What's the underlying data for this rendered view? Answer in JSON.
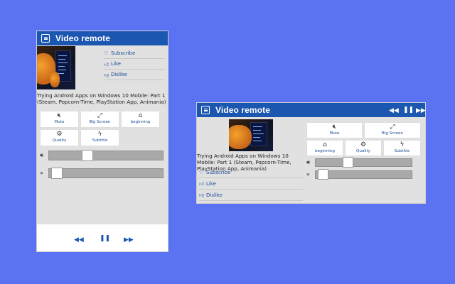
{
  "app": {
    "title": "Video remote"
  },
  "video": {
    "title": "Trying Android Apps on Windows 10 Mobile: Part 1 (Steam, Popcorn-Time, PlayStation App, Animania)"
  },
  "actions": {
    "subscribe": "Subscribe",
    "like": "Like",
    "dislike": "Dislike"
  },
  "controls": {
    "mute": "Mute",
    "big_screen": "Big Screen",
    "beginning": "beginning",
    "quality": "Quality",
    "subtitle": "Subtitle"
  },
  "icons": {
    "app": "list-icon",
    "subscribe": "heart-icon",
    "like": "thumbs-up-icon",
    "dislike": "thumbs-down-icon",
    "mute": "mute-icon",
    "big_screen": "expand-icon",
    "beginning": "home-icon",
    "quality": "gear-icon",
    "subtitle": "lightning-icon",
    "volume": "speaker-icon",
    "seek": "forward-icon",
    "rewind": "rewind-icon",
    "pause": "pause-icon",
    "fast_forward": "fast-forward-icon"
  },
  "sliders": {
    "volume_level": 0.32,
    "seek_position": 0.03
  },
  "colors": {
    "background": "#5b73f2",
    "titlebar": "#1b56b0",
    "panel": "#e1e1e1"
  }
}
